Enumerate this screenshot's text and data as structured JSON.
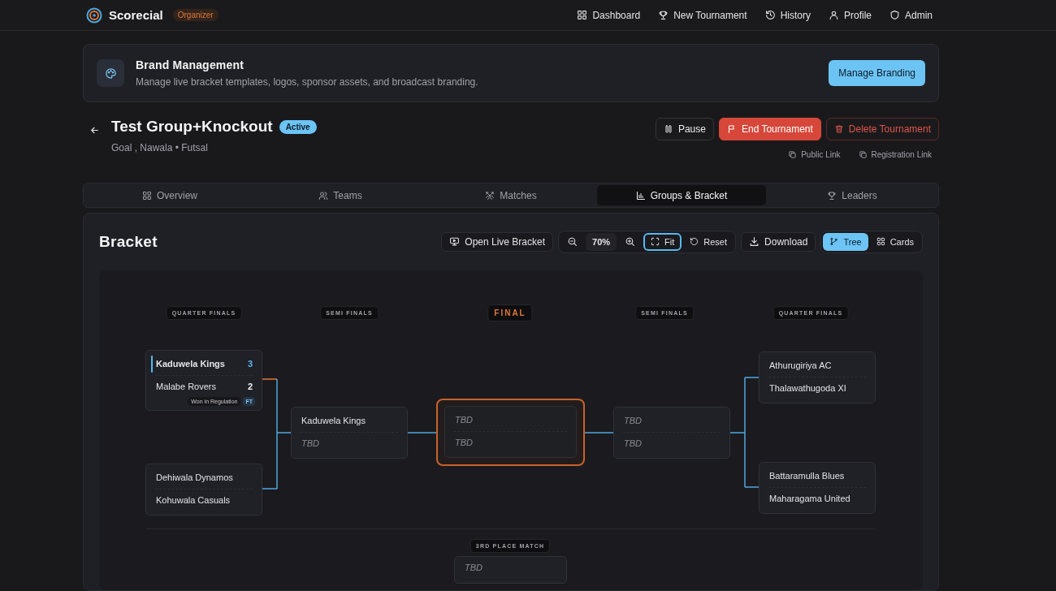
{
  "app": {
    "name": "Scorecial",
    "role": "Organizer"
  },
  "nav": [
    {
      "label": "Dashboard"
    },
    {
      "label": "New Tournament"
    },
    {
      "label": "History"
    },
    {
      "label": "Profile"
    },
    {
      "label": "Admin"
    }
  ],
  "brand_card": {
    "title": "Brand Management",
    "description": "Manage live bracket templates, logos, sponsor assets, and broadcast branding.",
    "button": "Manage Branding"
  },
  "tournament": {
    "title": "Test Group+Knockout",
    "status": "Active",
    "meta": "Goal , Nawala • Futsal",
    "actions": [
      {
        "label": "Pause",
        "kind": "neutral"
      },
      {
        "label": "End Tournament",
        "kind": "danger"
      },
      {
        "label": "Delete Tournament",
        "kind": "outline"
      }
    ],
    "links": [
      "Public Link",
      "Registration Link"
    ]
  },
  "tabs": [
    {
      "label": "Overview",
      "selected": false
    },
    {
      "label": "Teams",
      "selected": false
    },
    {
      "label": "Matches",
      "selected": false
    },
    {
      "label": "Groups & Bracket",
      "selected": true
    },
    {
      "label": "Leaders",
      "selected": false
    }
  ],
  "bracket": {
    "title": "Bracket",
    "toolbar": {
      "open_live": "Open Live Bracket",
      "zoom": "70%",
      "fit": {
        "label": "Fit",
        "focused": true
      },
      "reset": "Reset",
      "download": "Download",
      "views": [
        {
          "label": "Tree",
          "selected": true
        },
        {
          "label": "Cards",
          "selected": false
        }
      ]
    },
    "rounds": [
      {
        "label": "QUARTER FINALS",
        "kind": "round",
        "matches": [
          {
            "teams": [
              {
                "name": "Kaduwela Kings",
                "score": "3",
                "winner": true,
                "tbd": false
              },
              {
                "name": "Malabe Rovers",
                "score": "2",
                "winner": false,
                "tbd": false
              }
            ],
            "result": "Won in Regulation",
            "status": "FT"
          },
          {
            "teams": [
              {
                "name": "Dehiwala Dynamos",
                "winner": false,
                "tbd": false
              },
              {
                "name": "Kohuwala Casuals",
                "winner": false,
                "tbd": false
              }
            ]
          }
        ]
      },
      {
        "label": "SEMI FINALS",
        "kind": "round",
        "matches": [
          {
            "teams": [
              {
                "name": "Kaduwela Kings",
                "winner": false,
                "tbd": false
              },
              {
                "name": "TBD",
                "winner": false,
                "tbd": true
              }
            ]
          }
        ]
      },
      {
        "label": "FINAL",
        "kind": "final",
        "matches": [
          {
            "teams": [
              {
                "name": "TBD",
                "winner": false,
                "tbd": true
              },
              {
                "name": "TBD",
                "winner": false,
                "tbd": true
              }
            ]
          }
        ]
      },
      {
        "label": "SEMI FINALS",
        "kind": "round",
        "matches": [
          {
            "teams": [
              {
                "name": "TBD",
                "winner": false,
                "tbd": true
              },
              {
                "name": "TBD",
                "winner": false,
                "tbd": true
              }
            ]
          }
        ]
      },
      {
        "label": "QUARTER FINALS",
        "kind": "round",
        "matches": [
          {
            "teams": [
              {
                "name": "Athurugiriya AC",
                "winner": false,
                "tbd": false
              },
              {
                "name": "Thalawathugoda XI",
                "winner": false,
                "tbd": false
              }
            ]
          },
          {
            "teams": [
              {
                "name": "Battaramulla Blues",
                "winner": false,
                "tbd": false
              },
              {
                "name": "Maharagama United",
                "winner": false,
                "tbd": false
              }
            ]
          }
        ]
      }
    ],
    "third_place": {
      "label": "3RD PLACE MATCH",
      "teams": [
        {
          "name": "TBD",
          "winner": false,
          "tbd": true
        }
      ]
    }
  }
}
